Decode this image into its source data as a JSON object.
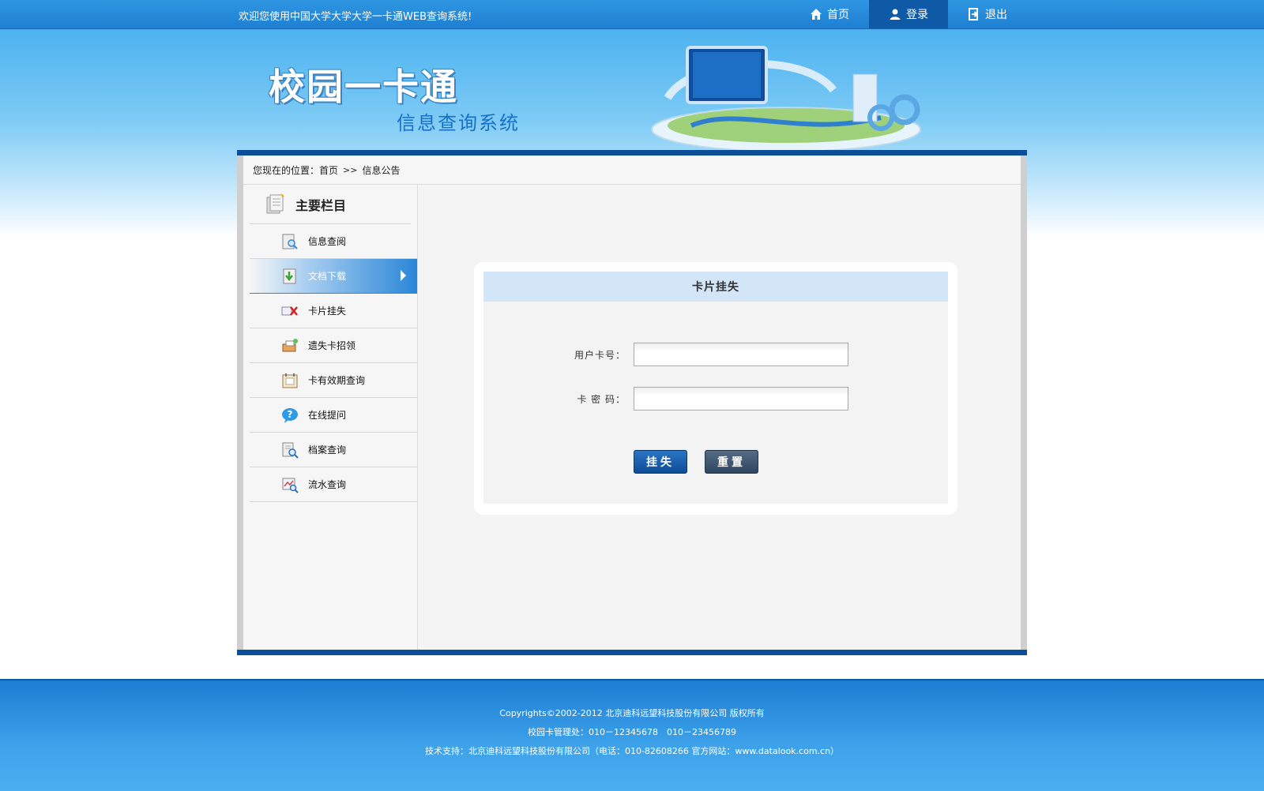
{
  "header": {
    "welcome": "欢迎您使用中国大学大学大学一卡通WEB查询系统!",
    "nav": [
      {
        "label": "首页",
        "icon": "home-icon"
      },
      {
        "label": "登录",
        "icon": "user-icon"
      },
      {
        "label": "退出",
        "icon": "logout-icon"
      }
    ]
  },
  "banner": {
    "title": "校园一卡通",
    "subtitle": "信息查询系统"
  },
  "breadcrumb": {
    "prefix": "您现在的位置：首页",
    "sep": ">>",
    "current": "信息公告"
  },
  "sidebar": {
    "title": "主要栏目",
    "items": [
      {
        "label": "信息查阅",
        "icon": "search-doc-icon"
      },
      {
        "label": "文档下载",
        "icon": "download-icon",
        "active": true
      },
      {
        "label": "卡片挂失",
        "icon": "card-lost-icon"
      },
      {
        "label": "遗失卡招领",
        "icon": "card-found-icon"
      },
      {
        "label": "卡有效期查询",
        "icon": "calendar-icon"
      },
      {
        "label": "在线提问",
        "icon": "question-icon"
      },
      {
        "label": "档案查询",
        "icon": "archive-search-icon"
      },
      {
        "label": "流水查询",
        "icon": "transaction-search-icon"
      }
    ]
  },
  "form": {
    "title": "卡片挂失",
    "card_label": "用户卡号：",
    "password_label": "卡 密 码：",
    "card_value": "",
    "password_value": "",
    "submit_label": "挂失",
    "reset_label": "重置"
  },
  "footer": {
    "line1": "Copyrights©2002-2012 北京迪科远望科技股份有限公司 版权所有",
    "line2": "校园卡管理处：010－12345678　010－23456789",
    "line3": "技术支持：北京迪科远望科技股份有限公司（电话：010-82608266 官方网站：www.datalook.com.cn）"
  },
  "colors": {
    "accent": "#1f7fd1",
    "nav_active": "#0f5aa6",
    "frame_border": "#0b4f9a",
    "form_head": "#d3e6f7"
  }
}
